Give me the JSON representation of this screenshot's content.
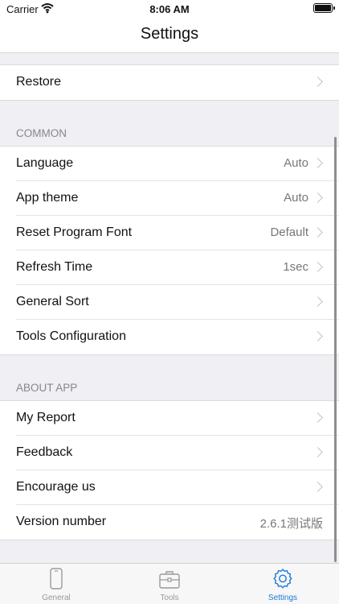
{
  "status_bar": {
    "carrier": "Carrier",
    "time": "8:06 AM"
  },
  "nav": {
    "title": "Settings"
  },
  "top_group": {
    "rows": [
      {
        "label": "Restore"
      }
    ]
  },
  "common": {
    "header": "COMMON",
    "rows": [
      {
        "label": "Language",
        "value": "Auto"
      },
      {
        "label": "App theme",
        "value": "Auto"
      },
      {
        "label": "Reset Program Font",
        "value": "Default"
      },
      {
        "label": "Refresh Time",
        "value": "1sec"
      },
      {
        "label": "General Sort"
      },
      {
        "label": "Tools Configuration"
      }
    ]
  },
  "about": {
    "header": "ABOUT APP",
    "rows": [
      {
        "label": "My Report"
      },
      {
        "label": "Feedback"
      },
      {
        "label": "Encourage us"
      },
      {
        "label": "Version number",
        "value": "2.6.1测试版"
      }
    ]
  },
  "tabs": [
    {
      "label": "General",
      "icon": "phone-icon"
    },
    {
      "label": "Tools",
      "icon": "toolbox-icon"
    },
    {
      "label": "Settings",
      "icon": "gear-icon",
      "active": true
    }
  ],
  "colors": {
    "accent": "#1a7ad8",
    "background": "#efeff4"
  }
}
